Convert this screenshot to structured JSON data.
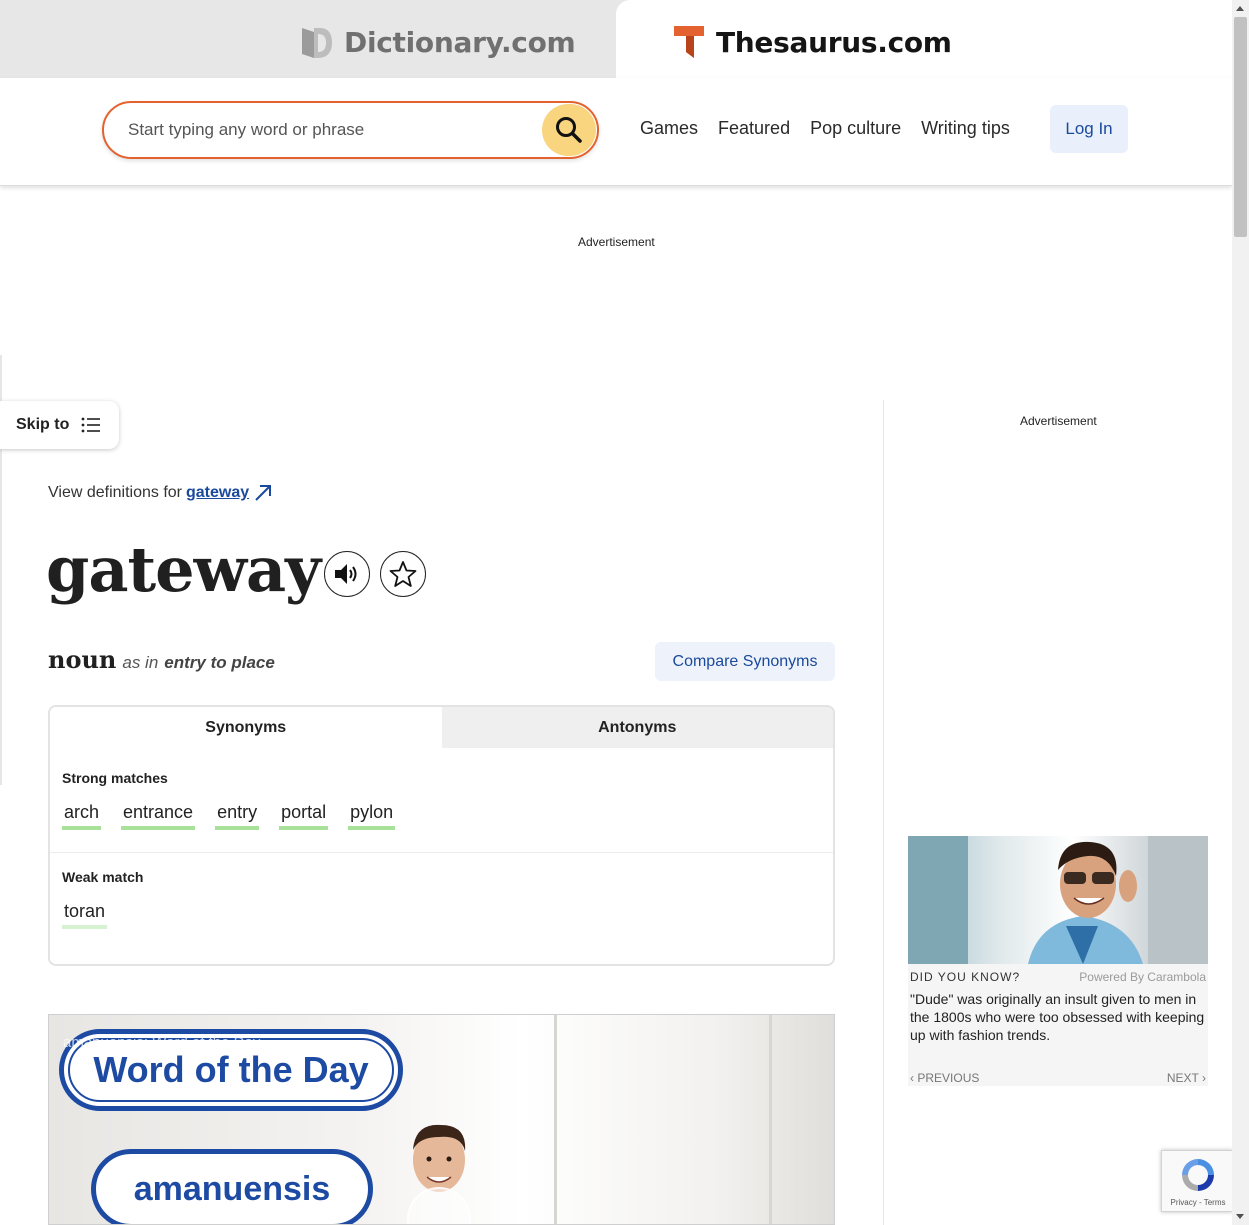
{
  "site_tabs": {
    "dictionary_label": "Dictionary.com",
    "thesaurus_label": "Thesaurus.com"
  },
  "header": {
    "search_placeholder": "Start typing any word or phrase",
    "nav": [
      "Games",
      "Featured",
      "Pop culture",
      "Writing tips"
    ],
    "login_label": "Log In"
  },
  "ads": {
    "top_label": "Advertisement",
    "side_label": "Advertisement"
  },
  "skip_to": {
    "label": "Skip to"
  },
  "entry": {
    "view_definitions_prefix": "View definitions for",
    "view_definitions_link": "gateway",
    "headword": "gateway",
    "part_of_speech": "noun",
    "as_in": "as in",
    "sense": "entry to place",
    "compare_label": "Compare Synonyms"
  },
  "synonyms_card": {
    "tabs": [
      "Synonyms",
      "Antonyms"
    ],
    "strong": {
      "title": "Strong matches",
      "words": [
        "arch",
        "entrance",
        "entry",
        "portal",
        "pylon"
      ]
    },
    "weak": {
      "title": "Weak match",
      "words": [
        "toran"
      ]
    }
  },
  "video": {
    "faded_title": "amanuensis: Word of the Day",
    "badge_title": "Word of the Day",
    "badge_word": "amanuensis"
  },
  "carambola": {
    "label": "DID YOU KNOW?",
    "powered_by": "Powered By Carambola",
    "fact": "\"Dude\" was originally an insult given to men in the 1800s who were too obsessed with keeping up with fashion trends.",
    "prev_label": "PREVIOUS",
    "next_label": "NEXT"
  },
  "recaptcha": {
    "label": "Privacy - Terms"
  },
  "colors": {
    "accent_orange": "#e3622f",
    "search_button": "#f8d57e",
    "link_blue": "#1a4a9c",
    "strong_underline": "#a8e29a",
    "weak_underline": "#d7f2d1"
  }
}
